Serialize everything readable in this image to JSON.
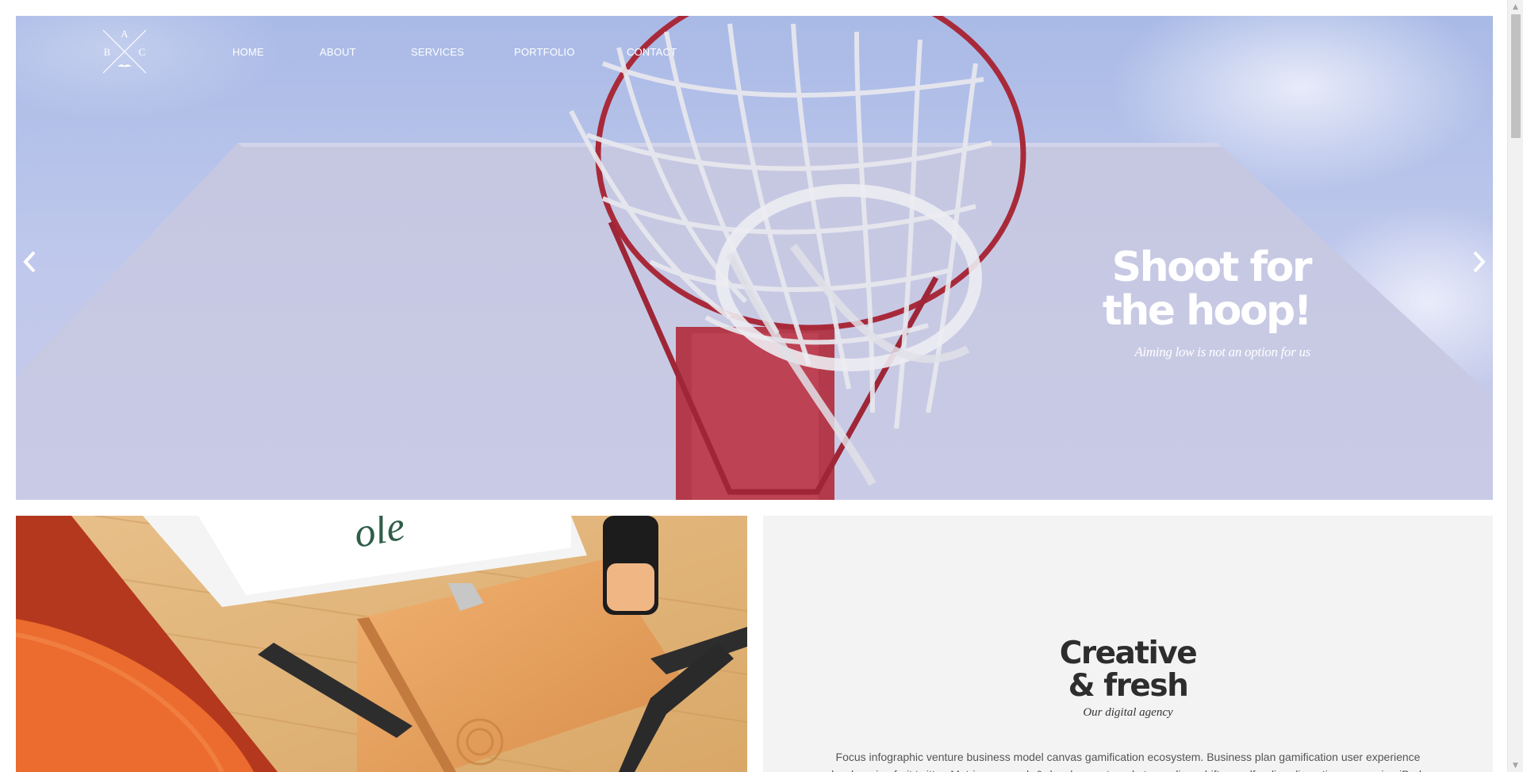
{
  "logo": {
    "letters": [
      "A",
      "B",
      "C"
    ],
    "icon": "mustache-icon"
  },
  "nav": {
    "items": [
      {
        "label": "HOME"
      },
      {
        "label": "ABOUT"
      },
      {
        "label": "SERVICES"
      },
      {
        "label": "PORTFOLIO"
      },
      {
        "label": "CONTACT"
      }
    ]
  },
  "hero": {
    "title_line1": "Shoot for",
    "title_line2": "the hoop!",
    "subtitle": "Aiming low is not an option for us",
    "prev_icon": "chevron-left-icon",
    "next_icon": "chevron-right-icon"
  },
  "feature": {
    "title_line1": "Creative",
    "title_line2": "& fresh",
    "subtitle": "Our digital agency",
    "body": "Focus infographic venture business model canvas gamification ecosystem. Business plan gamification user experience low hanging fruit twitter. Metrics research & development market paradigm shift crowdfunding disruptive conversion iPad."
  },
  "colors": {
    "hero_sky": "#aebde6",
    "rim": "#b8323f",
    "panel_bg": "#f3f3f3",
    "title_text": "#2d2d2d"
  }
}
